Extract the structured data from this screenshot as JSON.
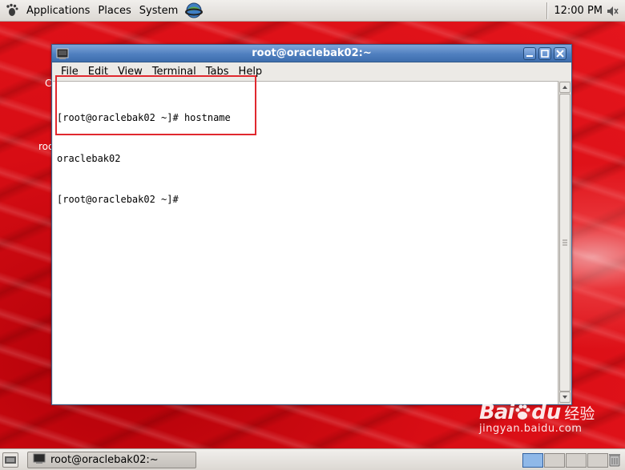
{
  "top_panel": {
    "menu": [
      "Applications",
      "Places",
      "System"
    ],
    "clock": "12:00 PM"
  },
  "desktop": {
    "fragment_1": "C",
    "fragment_2": "roo"
  },
  "window": {
    "title": "root@oraclebak02:~",
    "menubar": [
      "File",
      "Edit",
      "View",
      "Terminal",
      "Tabs",
      "Help"
    ],
    "terminal_lines": [
      "[root@oraclebak02 ~]# hostname",
      "oraclebak02",
      "[root@oraclebak02 ~]#"
    ]
  },
  "bottom_panel": {
    "task_label": "root@oraclebak02:~",
    "workspaces": 4,
    "active_workspace": 1
  },
  "watermark": {
    "brand": "Bai",
    "brand_suffix": "du",
    "jingyan": "经验",
    "url": "jingyan.baidu.com"
  },
  "colors": {
    "titlebar": "#4f7fbf",
    "highlight": "#e0282e",
    "desktop": "#d80d14"
  }
}
